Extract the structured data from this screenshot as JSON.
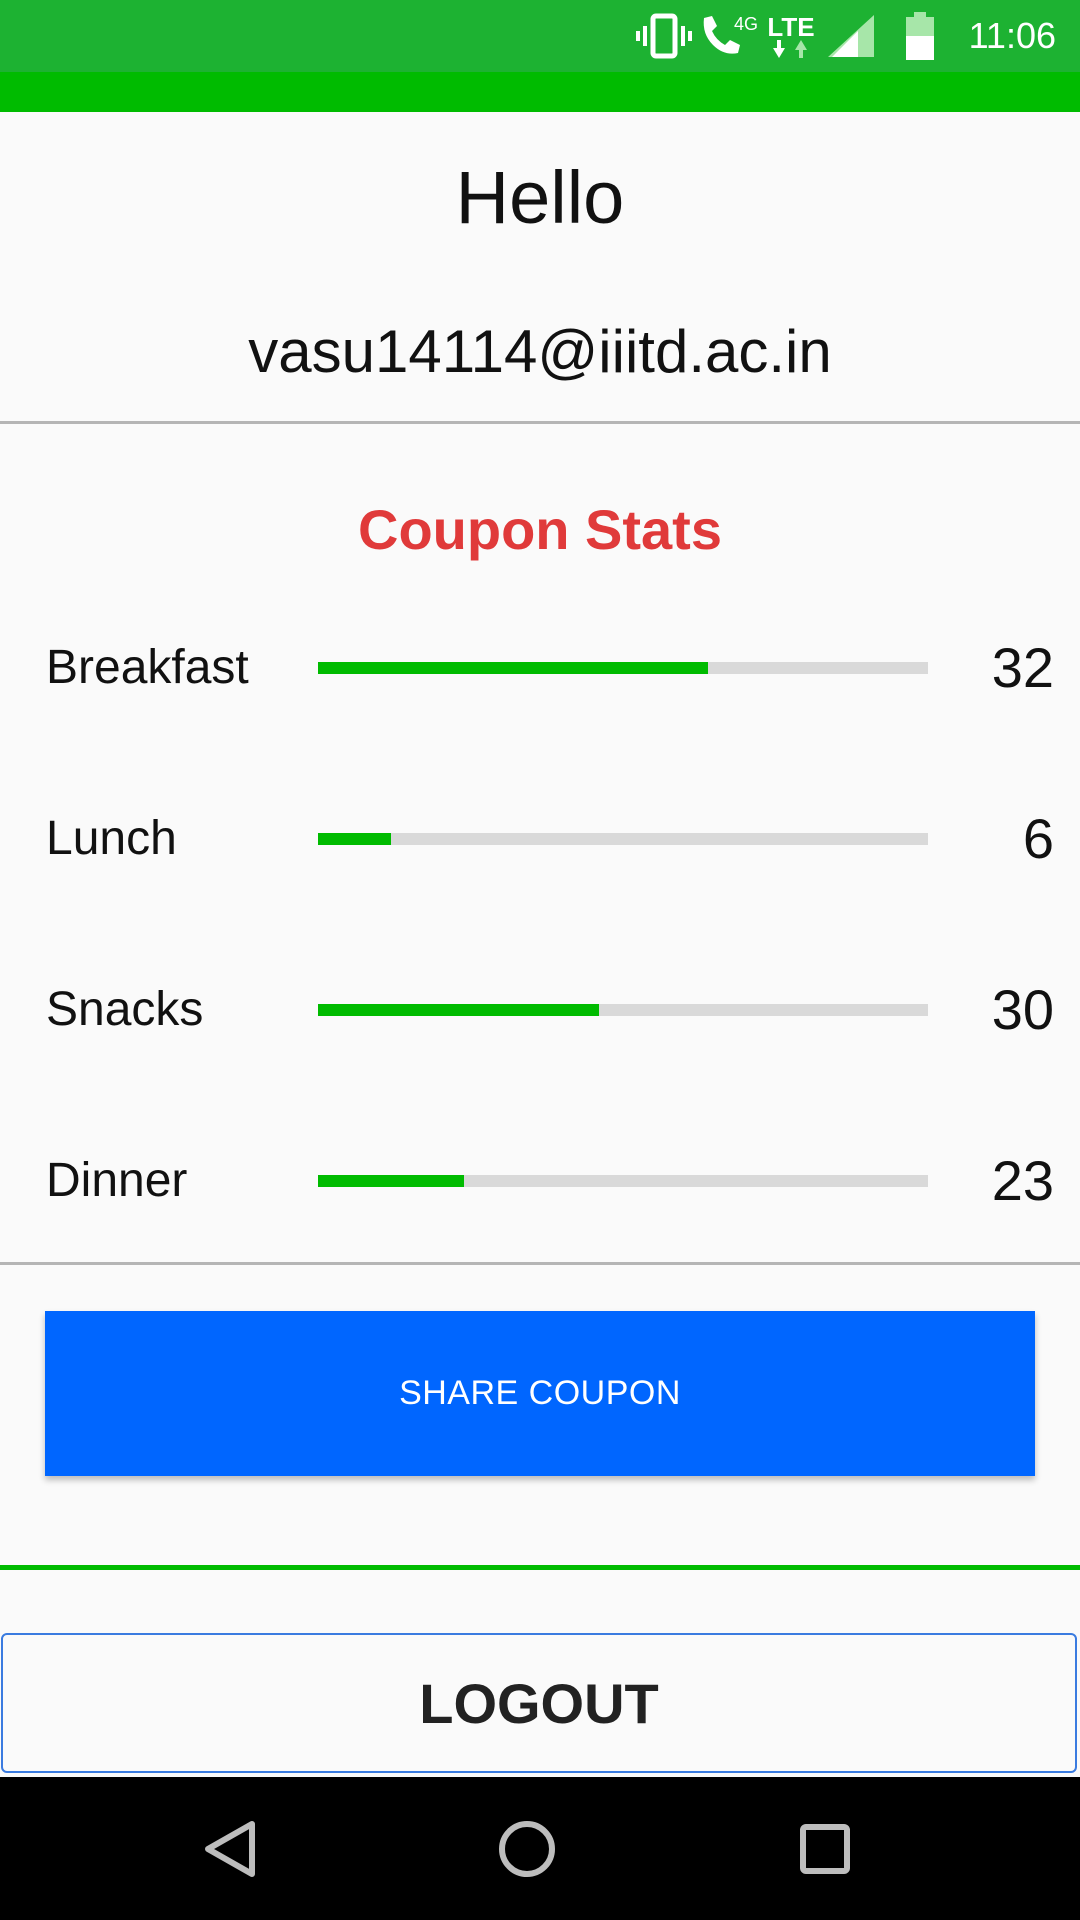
{
  "status_bar": {
    "time": "11:06",
    "network_label": "4G",
    "lte_label": "LTE",
    "icons": [
      "vibrate-icon",
      "call-icon",
      "lte-icon",
      "signal-icon",
      "battery-icon"
    ]
  },
  "header": {
    "greeting": "Hello",
    "email": "vasu14114@iiitd.ac.in"
  },
  "stats": {
    "title": "Coupon Stats",
    "items": [
      {
        "label": "Breakfast",
        "value": "32",
        "progress": 0.64
      },
      {
        "label": "Lunch",
        "value": "6",
        "progress": 0.12
      },
      {
        "label": "Snacks",
        "value": "30",
        "progress": 0.46
      },
      {
        "label": "Dinner",
        "value": "23",
        "progress": 0.24
      }
    ]
  },
  "actions": {
    "share_label": "SHARE COUPON",
    "logout_label": "LOGOUT"
  },
  "navigation": {
    "icons": [
      "back-icon",
      "home-icon",
      "recents-icon"
    ]
  },
  "colors": {
    "status_bar": "#1db232",
    "accent_green": "#00bb00",
    "title_red": "#e03a3a",
    "share_blue": "#0066ff",
    "track_gray": "#d9d9d9"
  }
}
